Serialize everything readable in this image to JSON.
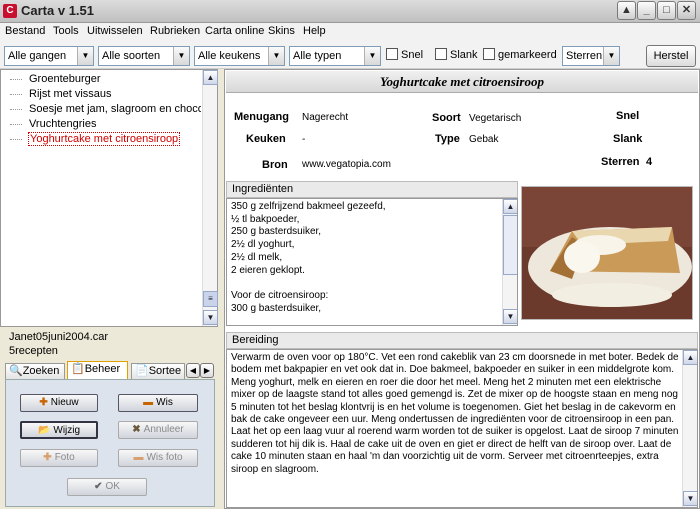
{
  "window": {
    "title": "Carta v 1.51",
    "icon_letter": "C"
  },
  "menu": [
    "Bestand",
    "Tools",
    "Uitwisselen",
    "Rubrieken",
    "Carta online",
    "Skins",
    "Help"
  ],
  "filters": {
    "gangen": "Alle gangen",
    "soorten": "Alle soorten",
    "keukens": "Alle keukens",
    "typen": "Alle typen",
    "snel": "Snel",
    "slank": "Slank",
    "gemarkeerd": "gemarkeerd",
    "sterren": "Sterren",
    "herstel": "Herstel"
  },
  "recipe_list": [
    "Groenteburger",
    "Rijst met vissaus",
    "Soesje met jam, slagroom en chocolad",
    "Vruchtengries",
    "Yoghurtcake met citroensiroop"
  ],
  "selected_recipe_index": 4,
  "file": {
    "name": "Janet05juni2004.car",
    "count": "5recepten"
  },
  "tabs": [
    "Zoeken",
    "Beheer",
    "Sortee"
  ],
  "actions": {
    "nieuw": "Nieuw",
    "wis": "Wis",
    "wijzig": "Wijzig",
    "annuleer": "Annuleer",
    "foto": "Foto",
    "wis_foto": "Wis foto",
    "ok": "OK"
  },
  "recipe": {
    "title": "Yoghurtcake met citroensiroop",
    "menugang_label": "Menugang",
    "menugang": "Nagerecht",
    "keuken_label": "Keuken",
    "keuken": "-",
    "bron_label": "Bron",
    "bron": "www.vegatopia.com",
    "soort_label": "Soort",
    "soort": "Vegetarisch",
    "type_label": "Type",
    "type": "Gebak",
    "snel_label": "Snel",
    "slank_label": "Slank",
    "sterren_label": "Sterren",
    "sterren": "4"
  },
  "ingredients_header": "Ingrediënten",
  "ingredients": [
    "350 g zelfrijzend bakmeel gezeefd,",
    "½ tl bakpoeder,",
    "250 g basterdsuiker,",
    "2½ dl yoghurt,",
    "2½ dl melk,",
    "2 eieren geklopt.",
    "",
    "Voor de citroensiroop:",
    "300 g basterdsuiker,"
  ],
  "bereiding_header": "Bereiding",
  "bereiding": "Verwarm de oven voor op 180°C. Vet een rond cakeblik van 23 cm doorsnede in met boter. Bedek de bodem met bakpapier en vet ook dat in. Doe bakmeel, bakpoeder en suiker in een middelgrote kom. Meng yoghurt, melk en eieren en roer die door het meel. Meng het 2 minuten met een elektrische mixer op de laagste stand tot alles goed gemengd is. Zet de mixer op de hoogste staan en meng nog 5 minuten tot het beslag klontvrij is en het volume is toegenomen. Giet het beslag in de cakevorm en bak de cake ongeveer een uur. Meng ondertussen de ingrediënten voor de citroensiroop in een pan. Laat het op een laag vuur al roerend warm worden tot de suiker is opgelost. Laat de siroop 7 minuten sudderen tot hij dik is. Haal de cake uit de oven en giet er direct de helft van de siroop over. Laat de cake 10 minuten staan en haal 'm dan voorzichtig uit de vorm. Serveer met citroenrteepjes, extra siroop en slagroom."
}
